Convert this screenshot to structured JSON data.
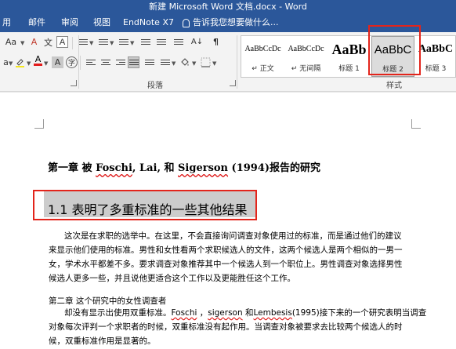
{
  "window": {
    "title": "新建 Microsoft Word 文档.docx - Word"
  },
  "tabs": [
    "用",
    "邮件",
    "审阅",
    "视图",
    "EndNote X7"
  ],
  "tell_me": "告诉我您想要做什么...",
  "ribbon": {
    "font_group_buttons": {
      "case": "Aa",
      "clear": "A",
      "phonetic": "文",
      "border": "A",
      "font_color": "A",
      "char_shade": "A",
      "enclose": "字"
    },
    "paragraph_label": "段落",
    "styles_label": "样式",
    "styles": [
      {
        "sample": "AaBbCcDc",
        "name": "↵ 正文"
      },
      {
        "sample": "AaBbCcDc",
        "name": "↵ 无间隔"
      },
      {
        "sample": "AaBb",
        "name": "标题 1"
      },
      {
        "sample": "AaBbC",
        "name": "标题 2"
      },
      {
        "sample": "AaBbC",
        "name": "标题 3"
      }
    ],
    "colors": {
      "highlight_marker": "#f5e71d",
      "font_color_bar": "#e31b1b",
      "selection_box": "#e3241b"
    }
  },
  "document": {
    "heading1": {
      "prefix": "第一章  被 ",
      "n1": "Foschi",
      "mid1": ", Lai,  和  ",
      "n2": "Sigerson",
      "suffix": " (1994)报告的研究"
    },
    "heading2": "1.1 表明了多重标准的一些其他结果",
    "para1": [
      "这次是在求职的选举中。在这里，不会直接询问调查对象使用过的标准，而是通过他们的建议",
      "来显示他们使用的标准。男性和女性看两个求职候选人的文件，这两个候选人是两个相似的一男一",
      "女，学术水平都差不多。要求调查对象推荐其中一个候选人到一个职位上。男性调查对象选择男性",
      "候选人更多一些，并且说他更适合这个工作以及更能胜任这个工作。"
    ],
    "subheading": "第二章  这个研究中的女性调查者",
    "para2": {
      "l1_prefix": "却没有显示出使用双重标准。",
      "l1_n1": "Foschi",
      "l1_sep": "  ，",
      "l1_n2": "sigerson",
      "l1_and": "  和",
      "l1_n3": "Lembesis",
      "l1_suffix": "(1995)接下来的一个研究表明当调查",
      "l2": "对象每次评判一个求职者的时候，双重标准没有起作用。当调查对象被要求去比较两个候选人的时",
      "l3": "候，双重标准作用是显著的。"
    }
  }
}
